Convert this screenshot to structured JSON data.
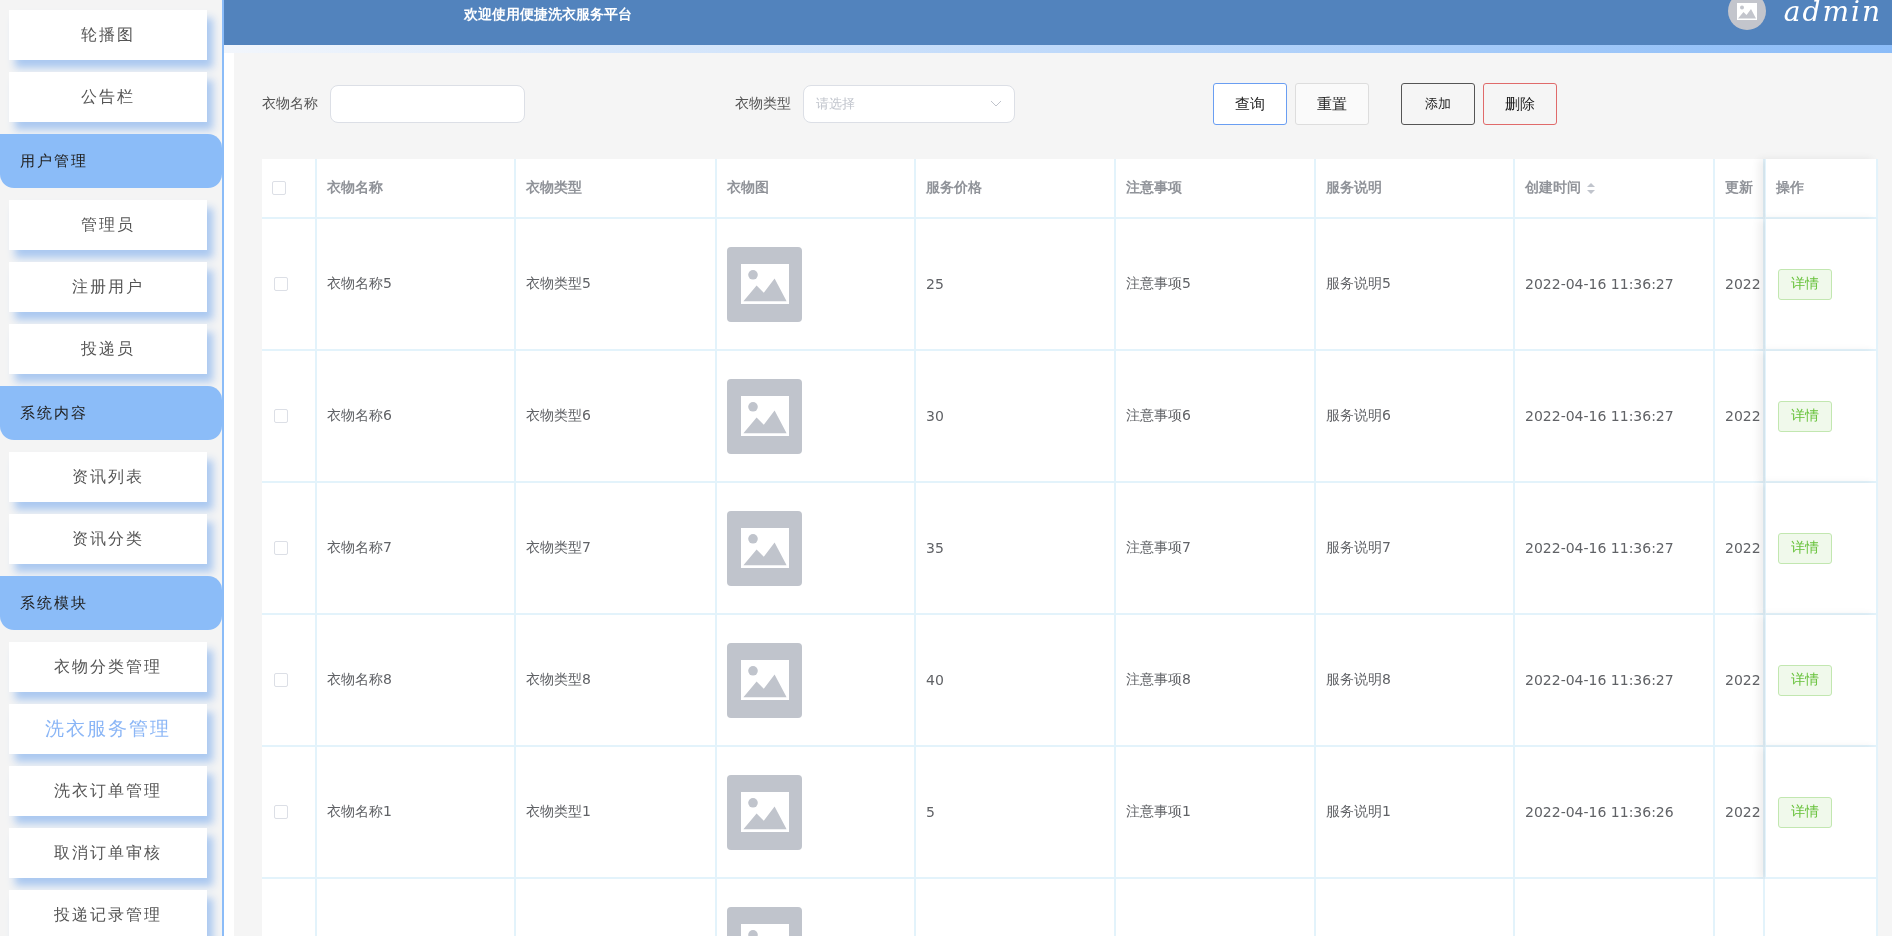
{
  "header": {
    "title": "欢迎使用便捷洗衣服务平台",
    "user": "admin"
  },
  "sidebar": {
    "items": [
      {
        "kind": "item",
        "label": "轮播图",
        "selected": false
      },
      {
        "kind": "item",
        "label": "公告栏",
        "selected": false
      },
      {
        "kind": "group",
        "label": "用户管理"
      },
      {
        "kind": "item",
        "label": "管理员",
        "selected": false
      },
      {
        "kind": "item",
        "label": "注册用户",
        "selected": false
      },
      {
        "kind": "item",
        "label": "投递员",
        "selected": false
      },
      {
        "kind": "group",
        "label": "系统内容"
      },
      {
        "kind": "item",
        "label": "资讯列表",
        "selected": false
      },
      {
        "kind": "item",
        "label": "资讯分类",
        "selected": false
      },
      {
        "kind": "group",
        "label": "系统模块"
      },
      {
        "kind": "item",
        "label": "衣物分类管理",
        "selected": false
      },
      {
        "kind": "item",
        "label": "洗衣服务管理",
        "selected": true
      },
      {
        "kind": "item",
        "label": "洗衣订单管理",
        "selected": false
      },
      {
        "kind": "item",
        "label": "取消订单审核",
        "selected": false
      },
      {
        "kind": "item",
        "label": "投递记录管理",
        "selected": false
      }
    ]
  },
  "filters": [
    {
      "label": "衣物名称",
      "kind": "text"
    },
    {
      "label": "衣物类型",
      "kind": "select",
      "placeholder": "请选择"
    }
  ],
  "buttons": [
    {
      "label": "查询",
      "kind": "primary"
    },
    {
      "label": "重置",
      "kind": "plain"
    },
    {
      "label": "添加",
      "kind": "dark"
    },
    {
      "label": "删除",
      "kind": "danger"
    }
  ],
  "table": {
    "select_all": {
      "checked": false
    },
    "columns": [
      {
        "label": "衣物名称"
      },
      {
        "label": "衣物类型"
      },
      {
        "label": "衣物图"
      },
      {
        "label": "服务价格"
      },
      {
        "label": "注意事项"
      },
      {
        "label": "服务说明"
      },
      {
        "label": "创建时间",
        "sortable": true
      },
      {
        "label": "更新"
      },
      {
        "label": "操作"
      }
    ],
    "rows": [
      {
        "checked": false,
        "image": true,
        "cells": [
          "衣物名称5",
          "衣物类型5",
          "25",
          "注意事项5",
          "服务说明5",
          "2022-04-16 11:36:27",
          "2022"
        ],
        "action": "详情"
      },
      {
        "checked": false,
        "image": true,
        "cells": [
          "衣物名称6",
          "衣物类型6",
          "30",
          "注意事项6",
          "服务说明6",
          "2022-04-16 11:36:27",
          "2022"
        ],
        "action": "详情"
      },
      {
        "checked": false,
        "image": true,
        "cells": [
          "衣物名称7",
          "衣物类型7",
          "35",
          "注意事项7",
          "服务说明7",
          "2022-04-16 11:36:27",
          "2022"
        ],
        "action": "详情"
      },
      {
        "checked": false,
        "image": true,
        "cells": [
          "衣物名称8",
          "衣物类型8",
          "40",
          "注意事项8",
          "服务说明8",
          "2022-04-16 11:36:27",
          "2022"
        ],
        "action": "详情"
      },
      {
        "checked": false,
        "image": true,
        "cells": [
          "衣物名称1",
          "衣物类型1",
          "5",
          "注意事项1",
          "服务说明1",
          "2022-04-16 11:36:26",
          "2022"
        ],
        "action": "详情"
      },
      {
        "image": true
      }
    ]
  }
}
